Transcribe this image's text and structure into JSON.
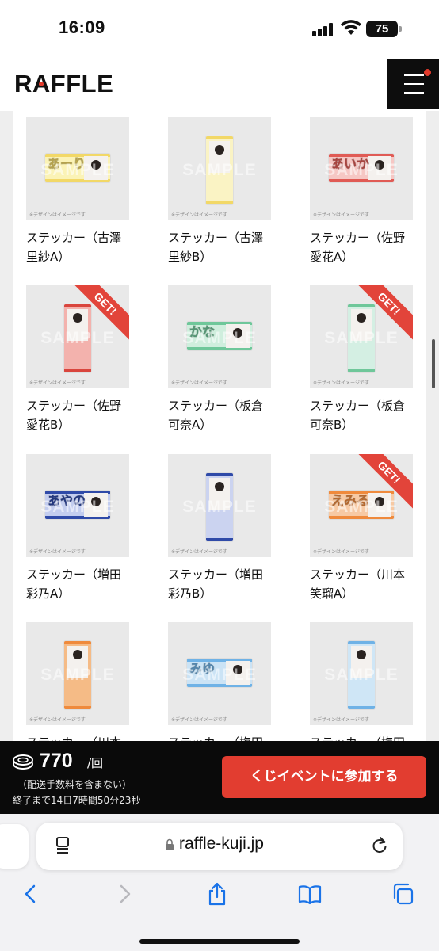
{
  "status_bar": {
    "time": "16:09",
    "battery": "75"
  },
  "header": {
    "logo": "RAFFLE"
  },
  "products": [
    {
      "label": "ステッカー（古澤\n里紗A）",
      "get": false,
      "orient": "h",
      "bg": "#fbf3b6",
      "band": "#f2d867",
      "letters": "あーり"
    },
    {
      "label": "ステッカー（古澤\n里紗B）",
      "get": false,
      "orient": "v",
      "bg": "#faf3c4",
      "band": "#f2d867",
      "letters": ""
    },
    {
      "label": "ステッカー（佐野\n愛花A）",
      "get": false,
      "orient": "h",
      "bg": "#f6c7c4",
      "band": "#e05b55",
      "letters": "あいか"
    },
    {
      "label": "ステッカー（佐野\n愛花B）",
      "get": true,
      "orient": "v",
      "bg": "#f3b2ad",
      "band": "#d9453d",
      "letters": ""
    },
    {
      "label": "ステッカー（板倉\n可奈A）",
      "get": false,
      "orient": "h",
      "bg": "#cfeedd",
      "band": "#6fc79a",
      "letters": "かな"
    },
    {
      "label": "ステッカー（板倉\n可奈B）",
      "get": true,
      "orient": "v",
      "bg": "#d4efe3",
      "band": "#6fc79a",
      "letters": ""
    },
    {
      "label": "ステッカー（増田\n彩乃A）",
      "get": false,
      "orient": "h",
      "bg": "#c3cdef",
      "band": "#2f4aa8",
      "letters": "あやの"
    },
    {
      "label": "ステッカー（増田\n彩乃B）",
      "get": false,
      "orient": "v",
      "bg": "#cbd3f0",
      "band": "#2f4aa8",
      "letters": ""
    },
    {
      "label": "ステッカー（川本\n笑瑠A）",
      "get": true,
      "orient": "h",
      "bg": "#f7c9a3",
      "band": "#ef8a3c",
      "letters": "えみる"
    },
    {
      "label": "ステッカー（川本",
      "get": false,
      "orient": "v",
      "bg": "#f5bb86",
      "band": "#ef8a3c",
      "letters": ""
    },
    {
      "label": "ステッカー（梅田",
      "get": false,
      "orient": "h",
      "bg": "#cbe3f5",
      "band": "#6fb2e6",
      "letters": "みゆ"
    },
    {
      "label": "ステッカー（梅田",
      "get": false,
      "orient": "v",
      "bg": "#cfe6f6",
      "band": "#6fb2e6",
      "letters": ""
    }
  ],
  "thumb_common": {
    "watermark": "SAMPLE",
    "note": "※デザインはイメージです",
    "get_badge": "GET!"
  },
  "purchase": {
    "price": "770",
    "per_unit": "/回",
    "fee_note": "（配送手数料を含まない）",
    "countdown": "終了まで14日7時間50分23秒",
    "join_button": "くじイベントに参加する"
  },
  "browser": {
    "url": "raffle-kuji.jp"
  },
  "colors": {
    "accent_red": "#e23d30",
    "bar_black": "#0a0a0a"
  }
}
